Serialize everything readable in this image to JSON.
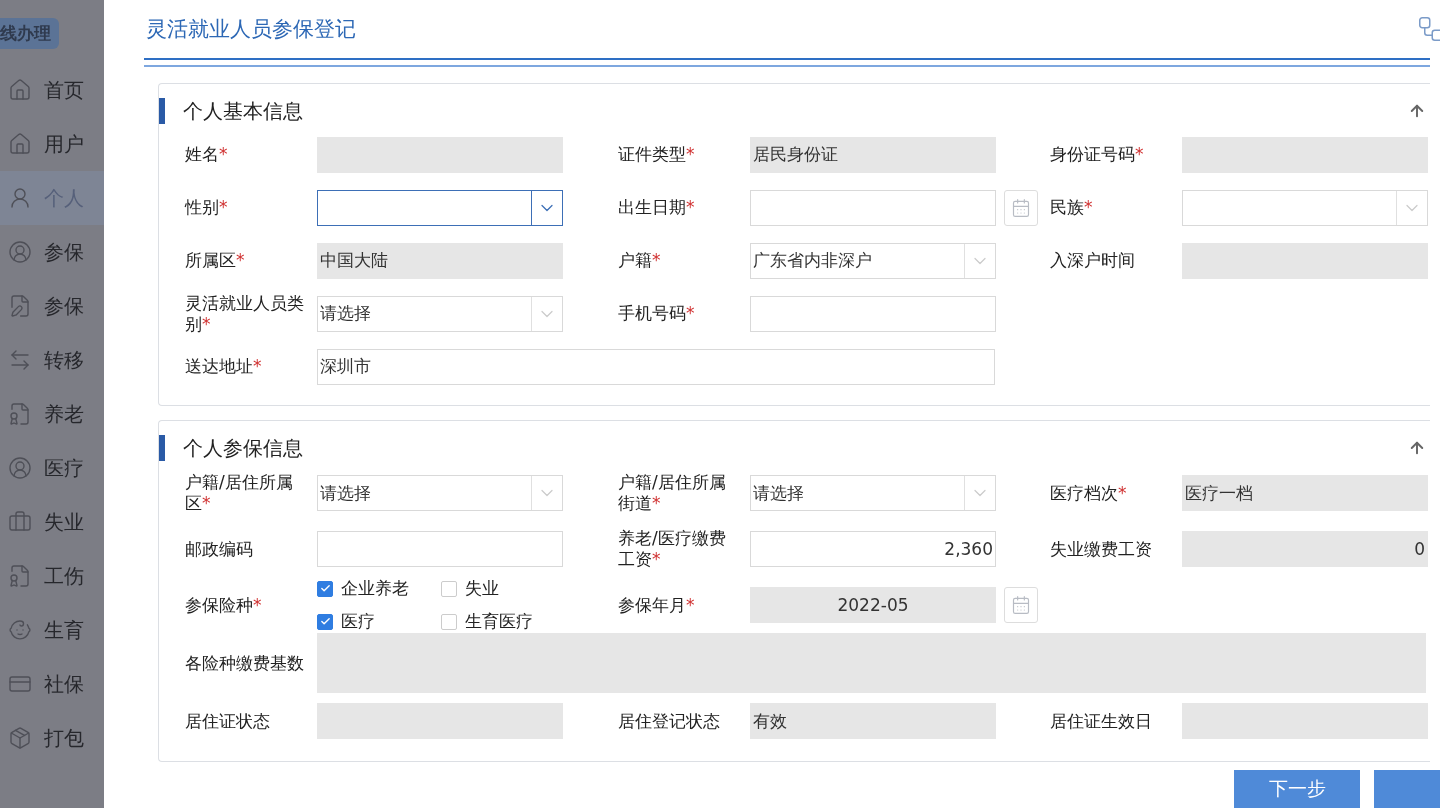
{
  "sidebar": {
    "badge": "线办理",
    "items": [
      {
        "label": "首页",
        "selected": false
      },
      {
        "label": "用户",
        "selected": false
      },
      {
        "label": "个人",
        "selected": true
      },
      {
        "label": "参保",
        "selected": false
      },
      {
        "label": "参保",
        "selected": false
      },
      {
        "label": "转移",
        "selected": false
      },
      {
        "label": "养老",
        "selected": false
      },
      {
        "label": "医疗",
        "selected": false
      },
      {
        "label": "失业",
        "selected": false
      },
      {
        "label": "工伤",
        "selected": false
      },
      {
        "label": "生育",
        "selected": false
      },
      {
        "label": "社保",
        "selected": false
      },
      {
        "label": "打包",
        "selected": false
      }
    ]
  },
  "dialog": {
    "title": "灵活就业人员参保登记",
    "sections": [
      {
        "title": "个人基本信息",
        "fields": [
          {
            "label": "姓名",
            "star": "*",
            "kind": "text",
            "readonly": true
          },
          {
            "label": "证件类型",
            "star": "*",
            "kind": "text",
            "readonly": true,
            "value": "居民身份证"
          },
          {
            "label": "身份证号码",
            "star": "*",
            "kind": "text",
            "readonly": true
          },
          {
            "label": "性别",
            "star": "*",
            "kind": "select",
            "focused": true
          },
          {
            "label": "出生日期",
            "star": "*",
            "kind": "date",
            "readonly": false
          },
          {
            "label": "民族",
            "star": "*",
            "kind": "select",
            "focused": false
          },
          {
            "label": "所属区",
            "star": "*",
            "kind": "text",
            "readonly": true,
            "value": "中国大陆"
          },
          {
            "label": "户籍",
            "star": "*",
            "kind": "select",
            "focused": false,
            "value": "广东省内非深户"
          },
          {
            "label": "入深户时间",
            "kind": "text",
            "readonly": true
          },
          {
            "label": "灵活就业人员类别",
            "star": "*",
            "kind": "select",
            "focused": false,
            "value": "请选择"
          },
          {
            "label": "手机号码",
            "star": "*",
            "kind": "text",
            "readonly": false
          },
          {
            "kind": "empty"
          },
          {
            "label": "送达地址",
            "star": "*",
            "kind": "long-text",
            "readonly": false,
            "value": "深圳市"
          }
        ]
      },
      {
        "title": "个人参保信息",
        "fields": [
          {
            "label": "户籍/居住所属区",
            "star": "*",
            "kind": "select",
            "focused": false,
            "value": "请选择"
          },
          {
            "label": "户籍/居住所属街道",
            "star": "*",
            "kind": "select",
            "focused": false,
            "value": "请选择"
          },
          {
            "label": "医疗档次",
            "star": "*",
            "kind": "text",
            "readonly": true,
            "value": "医疗一档"
          },
          {
            "label": "邮政编码",
            "kind": "text",
            "readonly": false
          },
          {
            "label": "养老/医疗缴费工资",
            "star": "*",
            "kind": "number",
            "readonly": false,
            "value": "2,360"
          },
          {
            "label": "失业缴费工资",
            "kind": "number",
            "readonly": true,
            "value": "0"
          },
          {
            "label": "参保险种",
            "star": "*",
            "kind": "checks",
            "options": [
              {
                "label": "企业养老",
                "checked": true
              },
              {
                "label": "失业",
                "checked": false
              },
              {
                "label": "医疗",
                "checked": true
              },
              {
                "label": "生育医疗",
                "checked": false
              }
            ]
          },
          {
            "label": "参保年月",
            "star": "*",
            "kind": "date",
            "readonly": true,
            "value": "2022-05"
          },
          {
            "kind": "empty"
          },
          {
            "label": "各险种缴费基数",
            "kind": "panel"
          },
          {
            "label": "居住证状态",
            "kind": "text",
            "readonly": true
          },
          {
            "label": "居住登记状态",
            "kind": "text",
            "readonly": true,
            "value": "有效"
          },
          {
            "label": "居住证生效日",
            "kind": "text",
            "readonly": true
          }
        ]
      }
    ],
    "buttons": [
      {
        "kind": "primary",
        "label": "下一步"
      },
      {
        "kind": "partial"
      }
    ]
  }
}
